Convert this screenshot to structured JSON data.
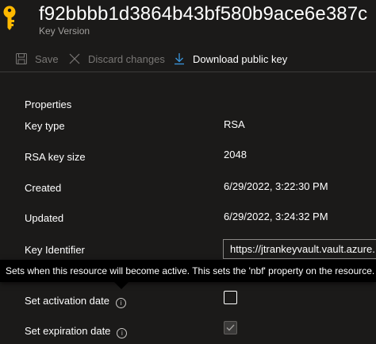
{
  "header": {
    "title": "f92bbbb1d3864b43bf580b9ace6e387c",
    "subtitle": "Key Version",
    "icon": "key-icon"
  },
  "toolbar": {
    "save_label": "Save",
    "discard_label": "Discard changes",
    "download_label": "Download public key"
  },
  "properties": {
    "section_title": "Properties",
    "key_type_label": "Key type",
    "key_type_value": "RSA",
    "key_size_label": "RSA key size",
    "key_size_value": "2048",
    "created_label": "Created",
    "created_value": "6/29/2022, 3:22:30 PM",
    "updated_label": "Updated",
    "updated_value": "6/29/2022, 3:24:32 PM",
    "key_identifier_label": "Key Identifier",
    "key_identifier_value": "https://jtrankeyvault.vault.azure.",
    "activation_label": "Set activation date",
    "activation_checked": false,
    "expiration_label": "Set expiration date",
    "expiration_checked": true,
    "expiration_disabled": true
  },
  "tooltip": {
    "text": "Sets when this resource will become active. This sets the 'nbf' property on the resource."
  },
  "colors": {
    "background": "#1b1a19",
    "key_icon": "#ffb900",
    "accent": "#3a96dd",
    "muted_text": "#a19f9d",
    "disabled_text": "#797775"
  }
}
